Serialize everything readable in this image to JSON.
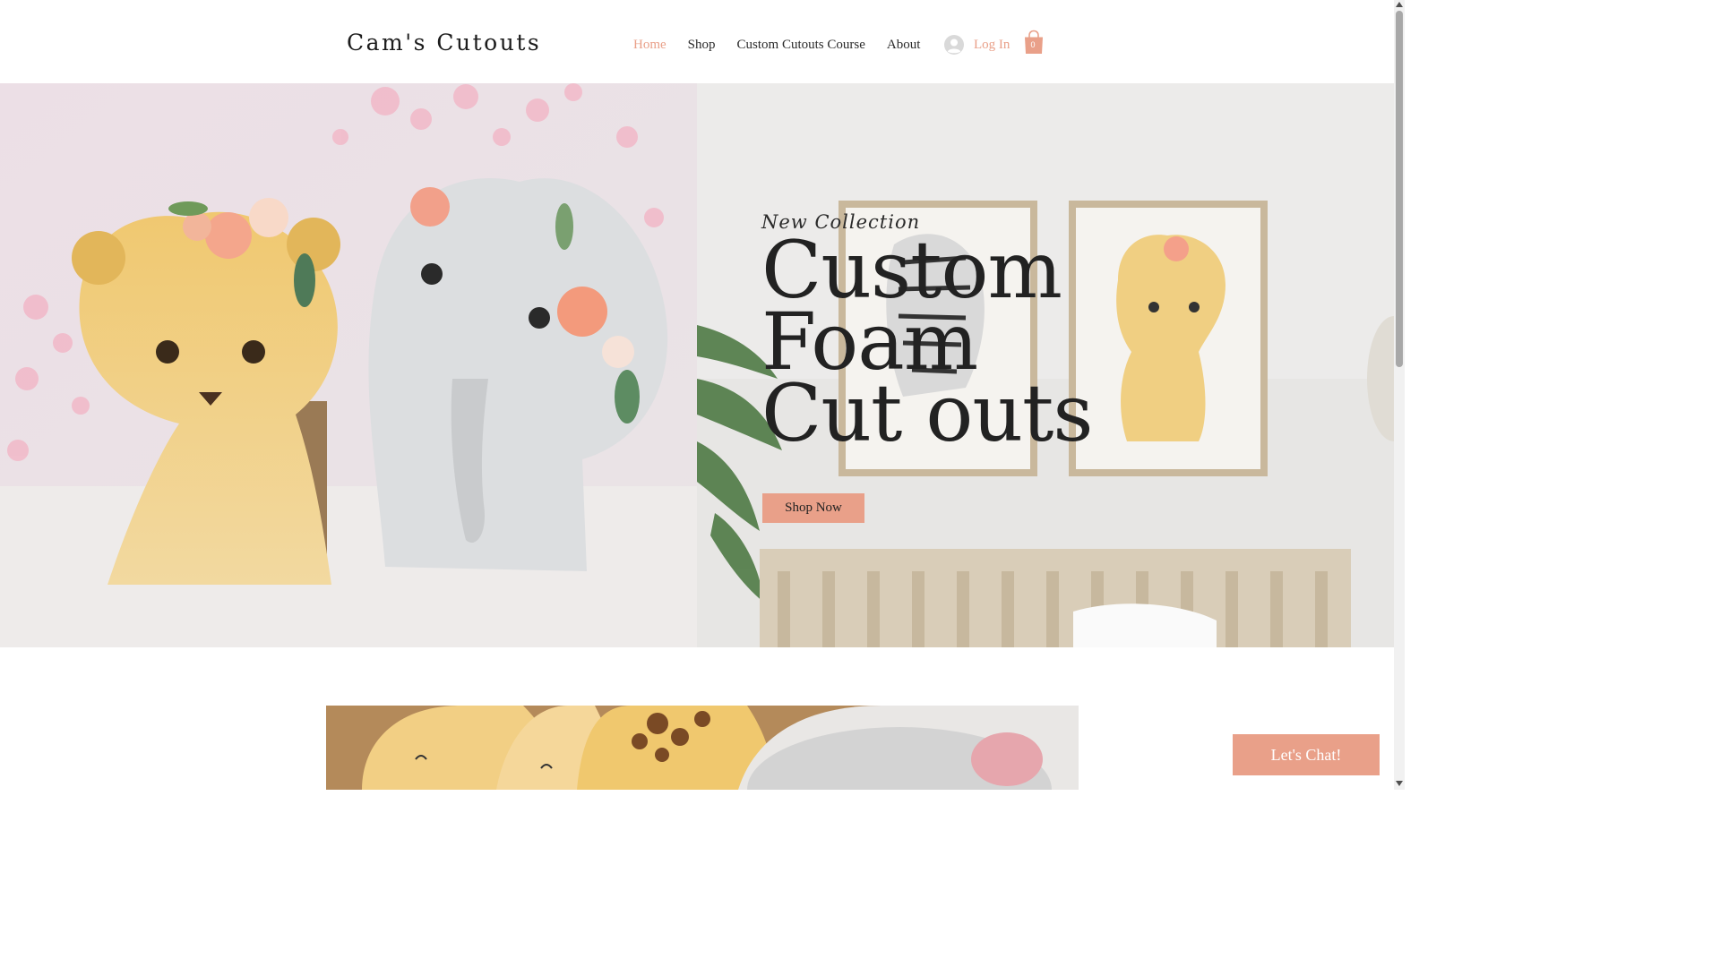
{
  "header": {
    "logo": "Cam's Cutouts",
    "nav": [
      {
        "label": "Home",
        "active": true
      },
      {
        "label": "Shop",
        "active": false
      },
      {
        "label": "Custom Cutouts Course",
        "active": false
      },
      {
        "label": "About",
        "active": false
      }
    ],
    "login_label": "Log In",
    "cart_count": "0"
  },
  "hero": {
    "eyebrow": "New Collection",
    "headline_line1": "Custom",
    "headline_line2": "Foam",
    "headline_line3": "Cut outs",
    "cta": "Shop Now"
  },
  "chat": {
    "label": "Let's Chat!"
  },
  "colors": {
    "accent": "#e9a089",
    "text": "#222222"
  },
  "icons": {
    "avatar": "user-avatar-icon",
    "cart": "shopping-bag-icon"
  }
}
